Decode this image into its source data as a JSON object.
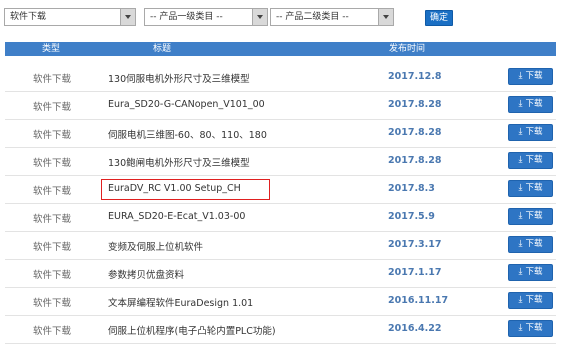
{
  "filters": {
    "category": "软件下载",
    "level1": "-- 产品一级类目 --",
    "level2": "-- 产品二级类目 --",
    "confirm_label": "确定"
  },
  "table": {
    "headers": {
      "type": "类型",
      "title": "标题",
      "date": "发布时间"
    },
    "download_label": "下载",
    "rows": [
      {
        "type": "软件下载",
        "title": "130伺服电机外形尺寸及三维模型",
        "date": "2017.12.8"
      },
      {
        "type": "软件下载",
        "title": "Eura_SD20-G-CANopen_V101_00",
        "date": "2017.8.28"
      },
      {
        "type": "软件下载",
        "title": "伺服电机三维图-60、80、110、180",
        "date": "2017.8.28"
      },
      {
        "type": "软件下载",
        "title": "130鲍闸电机外形尺寸及三维模型",
        "date": "2017.8.28"
      },
      {
        "type": "软件下载",
        "title": "EuraDV_RC V1.00 Setup_CH",
        "date": "2017.8.3",
        "highlighted": true
      },
      {
        "type": "软件下载",
        "title": "EURA_SD20-E-Ecat_V1.03-00",
        "date": "2017.5.9"
      },
      {
        "type": "软件下载",
        "title": "变频及伺服上位机软件",
        "date": "2017.3.17"
      },
      {
        "type": "软件下载",
        "title": "参数拷贝优盘资料",
        "date": "2017.1.17"
      },
      {
        "type": "软件下载",
        "title": "文本屏编程软件EuraDesign 1.01",
        "date": "2016.11.17"
      },
      {
        "type": "软件下载",
        "title": "伺服上位机程序(电子凸轮内置PLC功能)",
        "date": "2016.4.22"
      }
    ]
  },
  "colors": {
    "accent": "#3f7fc8",
    "button": "#2e75c4",
    "date": "#4a78b0",
    "highlight": "#e02020"
  }
}
